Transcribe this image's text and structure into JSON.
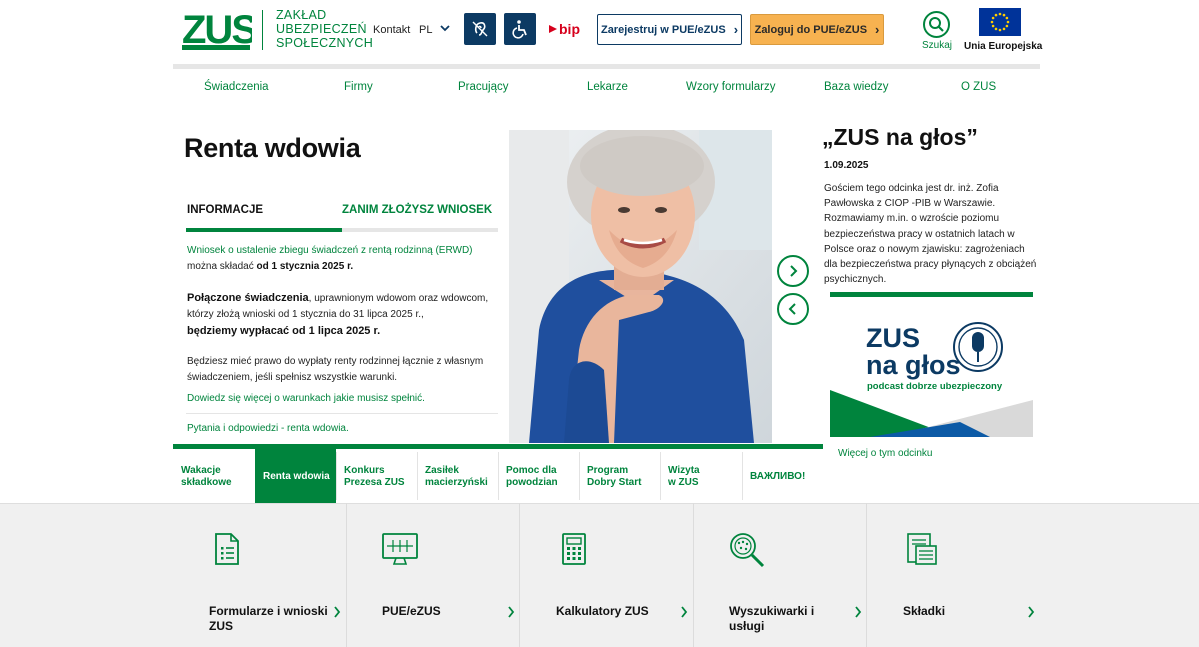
{
  "header": {
    "logo_text": "ZUS",
    "org_lines": [
      "ZAKŁAD",
      "UBEZPIECZEŃ",
      "SPOŁECZNYCH"
    ],
    "kontakt": "Kontakt",
    "lang": "PL",
    "bip_icon": "bip-logo",
    "register_button": "Zarejestruj w PUE/eZUS",
    "login_button": "Zaloguj do PUE/eZUS",
    "search_label": "Szukaj",
    "eu_label": "Unia Europejska"
  },
  "nav": {
    "items": [
      "Świadczenia",
      "Firmy",
      "Pracujący",
      "Lekarze",
      "Wzory formularzy",
      "Baza wiedzy",
      "O ZUS"
    ]
  },
  "main": {
    "title": "Renta wdowia",
    "tabs": [
      "INFORMACJE",
      "ZANIM ZŁOŻYSZ WNIOSEK"
    ],
    "p1_link": "Wniosek o ustalenie zbiegu świadczeń z rentą rodzinną (ERWD)",
    "p1_rest": " można składać ",
    "p1_bold": "od 1 stycznia 2025 r.",
    "p2_bold": "Połączone świadczenia",
    "p2_rest": ", uprawnionym wdowom oraz wdowcom, którzy złożą wnioski od 1 stycznia do 31 lipca 2025 r.,",
    "p2_bold2": "będziemy wypłacać od 1 lipca 2025 r.",
    "p3": "Będziesz mieć prawo do wypłaty renty rodzinnej łącznie z własnym świadczeniem, jeśli spełnisz wszystkie warunki.",
    "link1": "Dowiedz się więcej o warunkach jakie musisz spełnić.",
    "link2": "Pytania i odpowiedzi - renta wdowia."
  },
  "side": {
    "title": "„ZUS na głos”",
    "date": "1.09.2025",
    "text": "Gościem tego odcinka jest dr. inż. Zofia Pawłowska z CIOP -PIB w Warszawie. Rozmawiamy m.in. o wzroście poziomu bezpieczeństwa pracy w ostatnich latach w Polsce oraz o nowym zjawisku: zagrożeniach dla bezpieczeństwa pracy płynących z obciążeń psychicznych.",
    "podcast_line1": "ZUS",
    "podcast_line2": "na głos",
    "podcast_tagline": "podcast dobrze ubezpieczony",
    "link": "Więcej o tym odcinku"
  },
  "bottom_tabs": [
    {
      "label": "Wakacje składkowe",
      "l1": "Wakacje",
      "l2": "składkowe"
    },
    {
      "label": "Renta wdowia",
      "l1": "Renta wdowia",
      "l2": ""
    },
    {
      "label": "Konkurs Prezesa ZUS",
      "l1": "Konkurs",
      "l2": "Prezesa ZUS"
    },
    {
      "label": "Zasiłek macierzyński",
      "l1": "Zasiłek",
      "l2": "macierzyński"
    },
    {
      "label": "Pomoc dla powodzian",
      "l1": "Pomoc dla",
      "l2": "powodzian"
    },
    {
      "label": "Program Dobry Start",
      "l1": "Program",
      "l2": "Dobry Start"
    },
    {
      "label": "Wizyta w ZUS",
      "l1": "Wizyta",
      "l2": "w ZUS"
    },
    {
      "label": "ВАЖЛИВО!",
      "l1": "ВАЖЛИВО!",
      "l2": ""
    }
  ],
  "tiles": [
    {
      "l1": "Formularze i wnioski",
      "l2": "ZUS",
      "icon": "document-icon"
    },
    {
      "l1": "PUE/eZUS",
      "l2": "",
      "icon": "monitor-icon"
    },
    {
      "l1": "Kalkulatory ZUS",
      "l2": "",
      "icon": "calculator-icon"
    },
    {
      "l1": "Wyszukiwarki i",
      "l2": "usługi",
      "icon": "magnifier-icon"
    },
    {
      "l1": "Składki",
      "l2": "",
      "icon": "invoice-icon"
    }
  ],
  "colors": {
    "brand_green": "#00843d",
    "navy": "#0c3a63",
    "login_orange": "#f7b250"
  }
}
